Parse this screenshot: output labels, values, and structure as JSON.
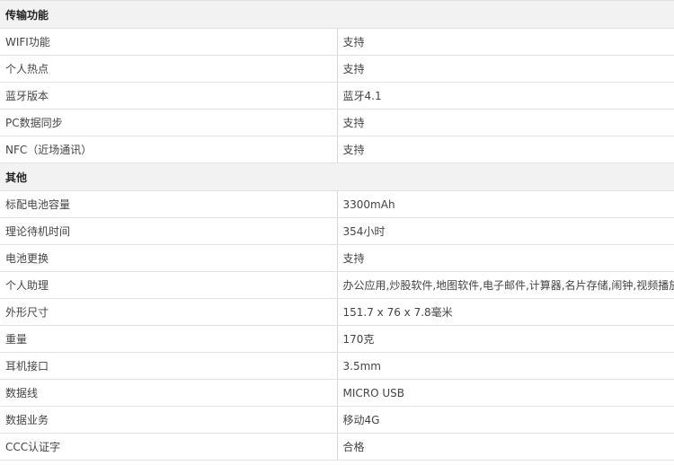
{
  "sections": [
    {
      "title": "传输功能",
      "rows": [
        {
          "label": "WIFI功能",
          "value": "支持"
        },
        {
          "label": "个人热点",
          "value": "支持"
        },
        {
          "label": "蓝牙版本",
          "value": "蓝牙4.1"
        },
        {
          "label": "PC数据同步",
          "value": "支持"
        },
        {
          "label": "NFC（近场通讯）",
          "value": "支持"
        }
      ]
    },
    {
      "title": "其他",
      "rows": [
        {
          "label": "标配电池容量",
          "value": "3300mAh"
        },
        {
          "label": "理论待机时间",
          "value": "354小时"
        },
        {
          "label": "电池更换",
          "value": "支持"
        },
        {
          "label": "个人助理",
          "value": "办公应用,炒股软件,地图软件,电子邮件,计算器,名片存储,闹钟,视频播放,彩信功能"
        },
        {
          "label": "外形尺寸",
          "value": "151.7 x 76 x 7.8毫米"
        },
        {
          "label": "重量",
          "value": "170克"
        },
        {
          "label": "耳机接口",
          "value": "3.5mm"
        },
        {
          "label": "数据线",
          "value": "MICRO USB"
        },
        {
          "label": "数据业务",
          "value": "移动4G"
        },
        {
          "label": "CCC认证字",
          "value": "合格"
        }
      ]
    }
  ]
}
